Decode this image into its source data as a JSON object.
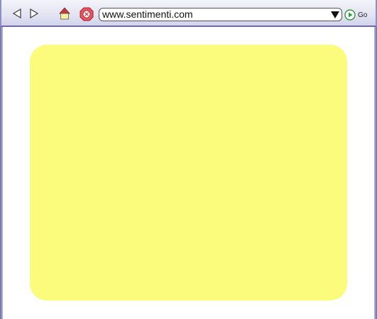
{
  "toolbar": {
    "back_icon": "back-arrow-icon",
    "forward_icon": "forward-arrow-icon",
    "home_icon": "home-icon",
    "stop_icon": "stop-icon",
    "address": "www.sentimenti.com",
    "go_label": "Go"
  },
  "content": {
    "panel_color": "#fcfc7c"
  },
  "colors": {
    "frame": "#6b6bab",
    "panel": "#fcfc7c",
    "home_roof": "#c43a3a",
    "stop_red": "#d63a4a",
    "go_green": "#2e9e3a"
  }
}
